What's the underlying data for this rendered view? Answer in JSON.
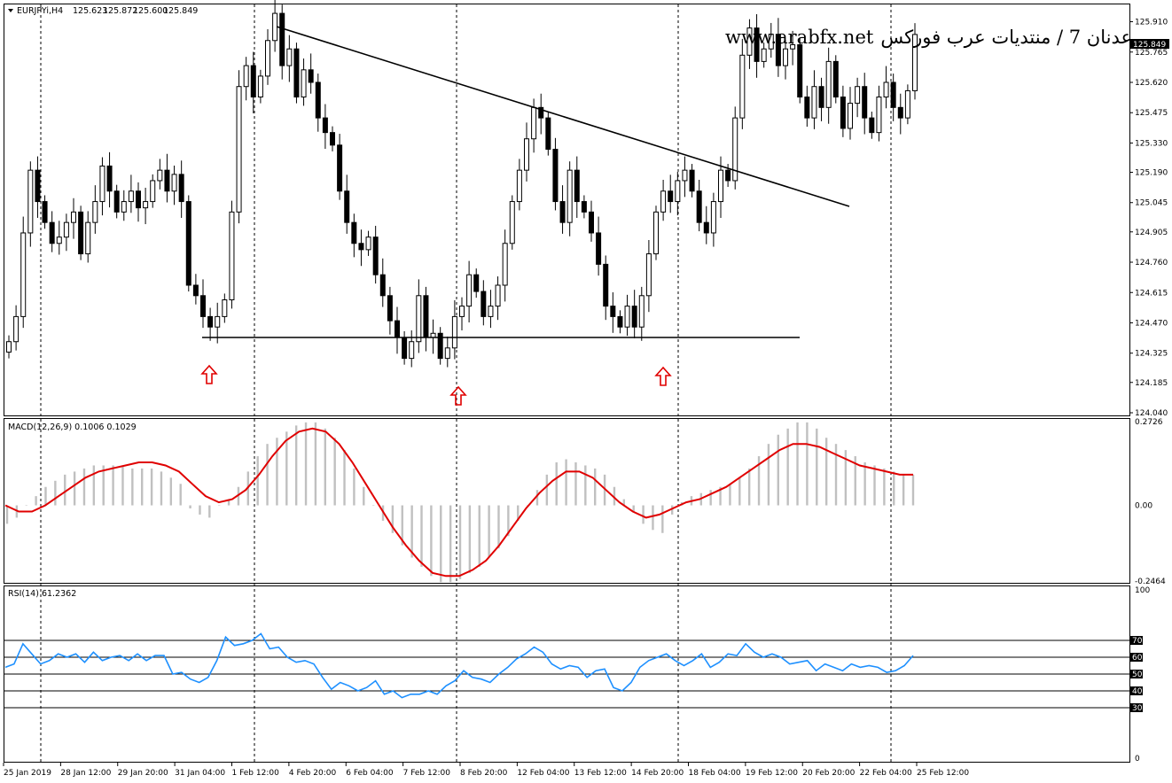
{
  "header": {
    "symbol": "EURJPYi,H4",
    "open": "125.623",
    "high": "125.872",
    "low": "125.600",
    "close": "125.849"
  },
  "watermark": {
    "url": "www.arabfx.net",
    "arabic": "عدنان 7 / منتديات عرب فوركس"
  },
  "price_axis": {
    "ticks": [
      "125.910",
      "125.765",
      "125.620",
      "125.475",
      "125.330",
      "125.190",
      "125.045",
      "124.905",
      "124.760",
      "124.615",
      "124.470",
      "124.325",
      "124.185",
      "124.040"
    ],
    "current_price": "125.849"
  },
  "macd": {
    "label": "MACD(12,26,9) 0.1006 0.1029",
    "ticks": [
      "0.2726",
      "0.00",
      "-0.2464"
    ]
  },
  "rsi": {
    "label": "RSI(14) 61.2362",
    "ticks": [
      "100",
      "70",
      "60",
      "50",
      "40",
      "30",
      "0"
    ]
  },
  "time_axis": [
    "25 Jan 2019",
    "28 Jan 12:00",
    "29 Jan 20:00",
    "31 Jan 04:00",
    "1 Feb 12:00",
    "4 Feb 20:00",
    "6 Feb 04:00",
    "7 Feb 12:00",
    "8 Feb 20:00",
    "12 Feb 04:00",
    "13 Feb 12:00",
    "14 Feb 20:00",
    "18 Feb 04:00",
    "19 Feb 12:00",
    "20 Feb 20:00",
    "22 Feb 04:00",
    "25 Feb 12:00"
  ],
  "colors": {
    "up_candle": "#ffffff",
    "down_candle": "#000000",
    "macd_histogram": "#c0c0c0",
    "macd_signal": "#e00000",
    "rsi_line": "#1e90ff",
    "arrow": "#e00000"
  },
  "chart_data": [
    {
      "type": "candlestick",
      "title": "EURJPYi,H4",
      "ylim": [
        124.04,
        125.98
      ],
      "closes": [
        124.38,
        124.5,
        124.9,
        125.2,
        125.05,
        124.95,
        124.85,
        124.88,
        124.95,
        125.0,
        124.8,
        124.95,
        125.05,
        125.22,
        125.1,
        125.0,
        125.05,
        125.1,
        125.02,
        125.05,
        125.15,
        125.2,
        125.1,
        125.18,
        125.05,
        124.65,
        124.6,
        124.5,
        124.45,
        124.5,
        124.58,
        125.0,
        125.6,
        125.7,
        125.55,
        125.65,
        125.82,
        125.95,
        125.7,
        125.78,
        125.55,
        125.68,
        125.62,
        125.45,
        125.38,
        125.32,
        125.1,
        124.95,
        124.85,
        124.82,
        124.88,
        124.7,
        124.6,
        124.48,
        124.4,
        124.3,
        124.38,
        124.6,
        124.4,
        124.42,
        124.3,
        124.35,
        124.5,
        124.55,
        124.7,
        124.62,
        124.5,
        124.55,
        124.65,
        124.85,
        125.05,
        125.2,
        125.35,
        125.5,
        125.45,
        125.3,
        125.05,
        124.95,
        125.2,
        125.05,
        125.0,
        124.9,
        124.75,
        124.55,
        124.5,
        124.45,
        124.55,
        124.45,
        124.6,
        124.8,
        125.0,
        125.1,
        125.05,
        125.15,
        125.2,
        125.1,
        124.95,
        124.9,
        125.05,
        125.2,
        125.15,
        125.45,
        125.75,
        125.88,
        125.72,
        125.78,
        125.85,
        125.7,
        125.78,
        125.8,
        125.55,
        125.45,
        125.6,
        125.5,
        125.72,
        125.55,
        125.4,
        125.52,
        125.6,
        125.45,
        125.38,
        125.55,
        125.62,
        125.5,
        125.45,
        125.58,
        125.849
      ],
      "annotations": [
        "descending trendline",
        "horizontal support line at 124.42",
        "three up arrows below support touches"
      ]
    },
    {
      "type": "bar",
      "title": "MACD(12,26,9) 0.1006 0.1029",
      "ylim": [
        -0.2464,
        0.2726
      ],
      "macd_values": [
        -0.06,
        -0.04,
        0.0,
        0.03,
        0.06,
        0.08,
        0.1,
        0.11,
        0.12,
        0.13,
        0.13,
        0.13,
        0.13,
        0.12,
        0.12,
        0.12,
        0.11,
        0.09,
        0.07,
        -0.01,
        -0.03,
        -0.04,
        0.0,
        0.02,
        0.06,
        0.11,
        0.16,
        0.2,
        0.22,
        0.24,
        0.26,
        0.27,
        0.27,
        0.25,
        0.22,
        0.18,
        0.12,
        0.06,
        0.0,
        -0.05,
        -0.09,
        -0.13,
        -0.17,
        -0.2,
        -0.23,
        -0.25,
        -0.25,
        -0.24,
        -0.22,
        -0.2,
        -0.17,
        -0.14,
        -0.1,
        -0.05,
        0.0,
        0.05,
        0.1,
        0.14,
        0.15,
        0.14,
        0.13,
        0.12,
        0.1,
        0.06,
        0.02,
        -0.02,
        -0.06,
        -0.08,
        -0.09,
        -0.03,
        0.01,
        0.03,
        0.04,
        0.05,
        0.06,
        0.07,
        0.09,
        0.12,
        0.16,
        0.2,
        0.23,
        0.25,
        0.27,
        0.27,
        0.25,
        0.22,
        0.2,
        0.18,
        0.16,
        0.14,
        0.13,
        0.12,
        0.11,
        0.1,
        0.1
      ],
      "signal_values": [
        0.0,
        -0.02,
        -0.02,
        0.0,
        0.03,
        0.06,
        0.09,
        0.11,
        0.12,
        0.13,
        0.14,
        0.14,
        0.13,
        0.11,
        0.07,
        0.03,
        0.01,
        0.02,
        0.05,
        0.1,
        0.16,
        0.21,
        0.24,
        0.25,
        0.24,
        0.2,
        0.14,
        0.07,
        0.0,
        -0.07,
        -0.13,
        -0.18,
        -0.22,
        -0.23,
        -0.23,
        -0.21,
        -0.18,
        -0.13,
        -0.07,
        -0.01,
        0.04,
        0.08,
        0.11,
        0.11,
        0.09,
        0.05,
        0.01,
        -0.02,
        -0.04,
        -0.03,
        -0.01,
        0.01,
        0.02,
        0.04,
        0.06,
        0.09,
        0.12,
        0.15,
        0.18,
        0.2,
        0.2,
        0.19,
        0.17,
        0.15,
        0.13,
        0.12,
        0.11,
        0.1,
        0.1
      ]
    },
    {
      "type": "line",
      "title": "RSI(14) 61.2362",
      "ylim": [
        0,
        100
      ],
      "levels": [
        70,
        60,
        50,
        40,
        30
      ],
      "values": [
        54,
        56,
        68,
        62,
        56,
        58,
        62,
        60,
        62,
        57,
        63,
        58,
        60,
        61,
        58,
        62,
        58,
        61,
        61,
        50,
        51,
        47,
        45,
        48,
        58,
        72,
        67,
        68,
        70,
        74,
        65,
        66,
        60,
        57,
        58,
        56,
        48,
        41,
        45,
        43,
        40,
        42,
        46,
        38,
        40,
        36,
        38,
        38,
        40,
        38,
        43,
        46,
        52,
        48,
        47,
        45,
        50,
        54,
        59,
        62,
        66,
        63,
        56,
        53,
        55,
        54,
        48,
        52,
        53,
        42,
        40,
        45,
        54,
        58,
        60,
        62,
        58,
        55,
        58,
        62,
        54,
        57,
        62,
        61,
        68,
        63,
        60,
        62,
        60,
        56,
        57,
        58,
        52,
        56,
        54,
        52,
        56,
        54,
        55,
        54,
        51,
        52,
        55,
        61
      ]
    }
  ]
}
